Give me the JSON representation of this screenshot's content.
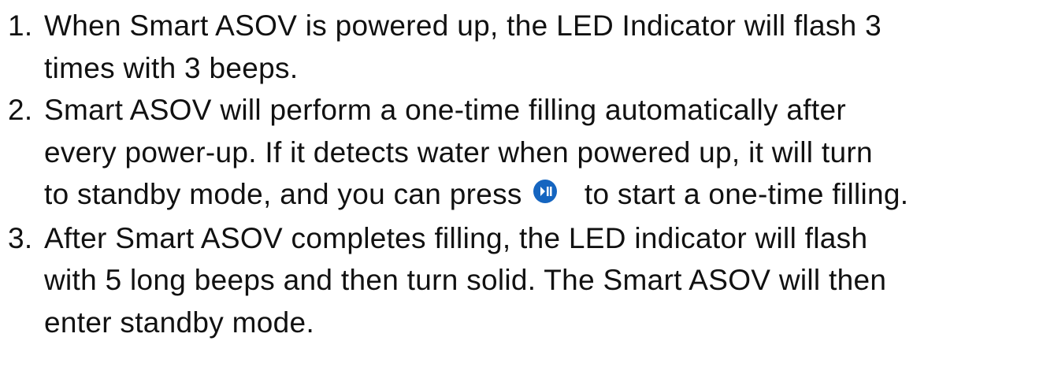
{
  "instructions": {
    "steps": [
      {
        "number": "1.",
        "lines": [
          "When Smart ASOV is powered up, the LED Indicator will flash 3",
          "times with 3 beeps."
        ]
      },
      {
        "number": "2.",
        "lines": [
          "Smart ASOV will perform a one-time filling automatically after",
          "every power-up. If it detects water when powered up, it will turn"
        ],
        "line3_before_icon": "to standby mode, and you can press",
        "line3_after_icon": "to start a one-time filling.",
        "icon": "play-pause-icon",
        "icon_color": "#1565C0"
      },
      {
        "number": "3.",
        "lines": [
          "After Smart ASOV completes filling, the LED indicator will flash",
          "with 5 long beeps and then turn solid. The Smart ASOV will then",
          "enter standby mode."
        ]
      }
    ]
  }
}
